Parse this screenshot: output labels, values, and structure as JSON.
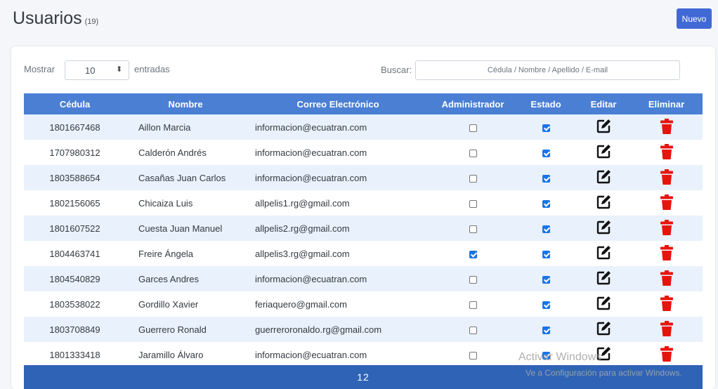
{
  "header": {
    "title": "Usuarios",
    "count": "(19)",
    "new_button": "Nuevo"
  },
  "controls": {
    "show_label": "Mostrar",
    "page_size": "10",
    "entries_label": "entradas",
    "search_label": "Buscar:",
    "search_placeholder": "Cédula / Nombre / Apellido / E-mail",
    "search_value": ""
  },
  "table": {
    "columns": [
      "Cédula",
      "Nombre",
      "Correo Electrónico",
      "Administrador",
      "Estado",
      "Editar",
      "Eliminar"
    ],
    "rows": [
      {
        "cedula": "1801667468",
        "nombre": "Aillon Marcia",
        "correo": "informacion@ecuatran.com",
        "admin": false,
        "estado": true
      },
      {
        "cedula": "1707980312",
        "nombre": "Calderón Andrés",
        "correo": "informacion@ecuatran.com",
        "admin": false,
        "estado": true
      },
      {
        "cedula": "1803588654",
        "nombre": "Casañas Juan Carlos",
        "correo": "informacion@ecuatran.com",
        "admin": false,
        "estado": true
      },
      {
        "cedula": "1802156065",
        "nombre": "Chicaiza Luis",
        "correo": "allpelis1.rg@gmail.com",
        "admin": false,
        "estado": true
      },
      {
        "cedula": "1801607522",
        "nombre": "Cuesta Juan Manuel",
        "correo": "allpelis2.rg@gmail.com",
        "admin": false,
        "estado": true
      },
      {
        "cedula": "1804463741",
        "nombre": "Freire Ángela",
        "correo": "allpelis3.rg@gmail.com",
        "admin": true,
        "estado": true
      },
      {
        "cedula": "1804540829",
        "nombre": "Garces Andres",
        "correo": "informacion@ecuatran.com",
        "admin": false,
        "estado": true
      },
      {
        "cedula": "1803538022",
        "nombre": "Gordillo Xavier",
        "correo": "feriaquero@gmail.com",
        "admin": false,
        "estado": true
      },
      {
        "cedula": "1803708849",
        "nombre": "Guerrero Ronald",
        "correo": "guerreroronaldo.rg@gmail.com",
        "admin": false,
        "estado": true
      },
      {
        "cedula": "1801333418",
        "nombre": "Jaramillo Álvaro",
        "correo": "informacion@ecuatran.com",
        "admin": false,
        "estado": true
      }
    ]
  },
  "pagination": {
    "pages": "12"
  },
  "watermark": {
    "line1": "Activar Windows",
    "line2": "Ve a Configuración para activar Windows."
  },
  "icons": {
    "edit": "edit-icon",
    "delete": "trash-icon"
  },
  "colors": {
    "header_bg": "#4a7fd4",
    "row_alt": "#e9f1fc",
    "delete": "#e8140c",
    "footer": "#2f63b5",
    "button": "#4169d6"
  }
}
